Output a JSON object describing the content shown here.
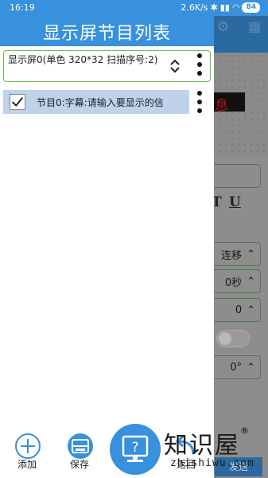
{
  "status_bar": {
    "time": "16:19",
    "network_speed": "2.6K/s",
    "battery_level": "84"
  },
  "background": {
    "led_preview_text": "息",
    "mode_value": "连移",
    "duration_value": "0秒",
    "number_value": "0",
    "angle_value": "0°",
    "bottom_button": "发送"
  },
  "drawer": {
    "title": "显示屏节目列表",
    "screen_item": "显示屏0(单色 320*32 扫描序号:2)",
    "program_item": "节目0:字幕:请输入要显示的信"
  },
  "toolbar": {
    "add_label": "添加",
    "save_label": "保存",
    "return_label": "返回"
  },
  "watermark": {
    "logo_text": "知识屋",
    "registered": "®",
    "url": "zhishiwu.com"
  },
  "colors": {
    "accent": "#3791dc",
    "selected_row": "#bed2ea",
    "border_green": "#6cb944"
  }
}
